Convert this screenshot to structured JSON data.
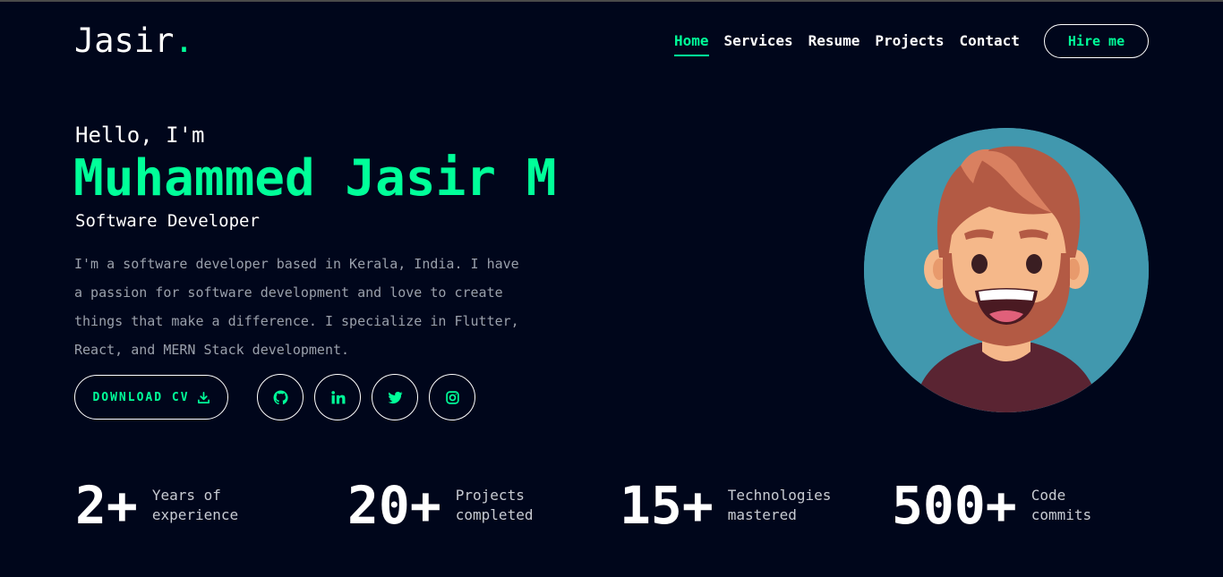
{
  "header": {
    "logo_text": "Jasir",
    "logo_dot": ".",
    "nav": [
      {
        "label": "Home",
        "active": true
      },
      {
        "label": "Services",
        "active": false
      },
      {
        "label": "Resume",
        "active": false
      },
      {
        "label": "Projects",
        "active": false
      },
      {
        "label": "Contact",
        "active": false
      }
    ],
    "hire_label": "Hire me"
  },
  "hero": {
    "greeting": "Hello, I'm",
    "name": "Muhammed Jasir M",
    "role": "Software Developer",
    "bio": "I'm a software developer based in Kerala, India. I have a passion for software development and love to create things that make a difference. I specialize in Flutter, React, and MERN Stack development.",
    "cv_label": "DOWNLOAD CV",
    "socials": [
      {
        "icon": "github-icon"
      },
      {
        "icon": "linkedin-icon"
      },
      {
        "icon": "twitter-icon"
      },
      {
        "icon": "instagram-icon"
      }
    ]
  },
  "stats": [
    {
      "value": "2+",
      "line1": "Years of",
      "line2": "experience"
    },
    {
      "value": "20+",
      "line1": "Projects",
      "line2": "completed"
    },
    {
      "value": "15+",
      "line1": "Technologies",
      "line2": "mastered"
    },
    {
      "value": "500+",
      "line1": "Code",
      "line2": "commits"
    }
  ],
  "colors": {
    "background": "#00061b",
    "accent": "#00ff99",
    "muted_text": "#9aa0ab",
    "avatar_bg": "#4198ae"
  }
}
